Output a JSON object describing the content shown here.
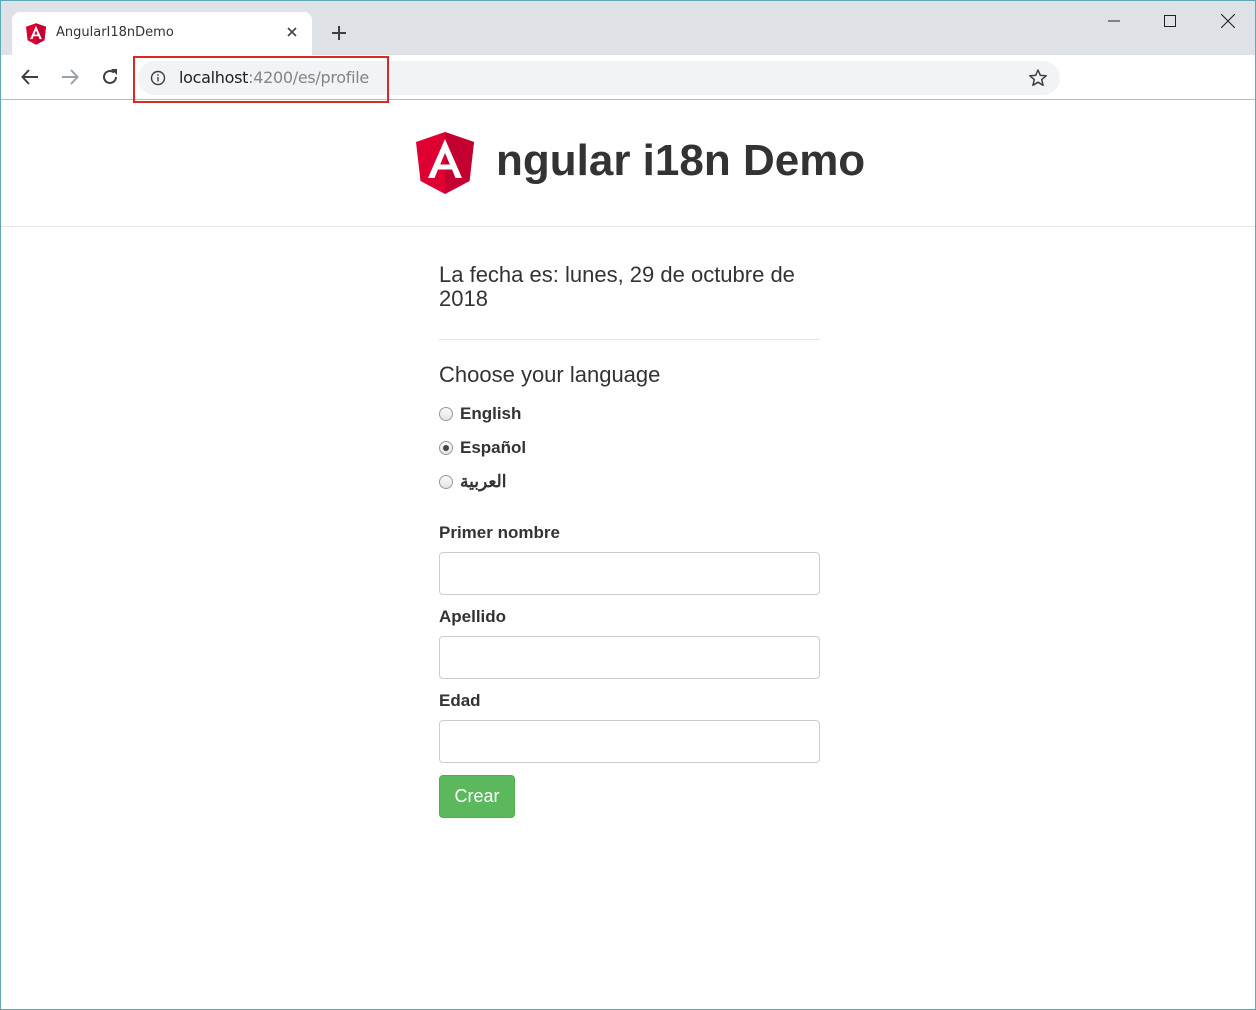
{
  "browser": {
    "tab": {
      "title": "AngularI18nDemo",
      "favicon": "angular-logo-icon",
      "close_icon": "close-icon"
    },
    "new_tab_icon": "plus-icon",
    "window_controls": [
      "minimize-icon",
      "maximize-icon",
      "close-icon"
    ],
    "toolbar": {
      "nav_icons": [
        "back-arrow-icon",
        "forward-arrow-icon",
        "reload-icon"
      ],
      "url_host": "localhost",
      "url_path": ":4200/es/profile",
      "info_icon": "info-icon",
      "bookmark_icon": "star-icon"
    },
    "highlight_color": "#d42a2a"
  },
  "app": {
    "title": "ngular i18n Demo",
    "logo_color": "#dd0031",
    "date_text": "La fecha es: lunes, 29 de octubre de 2018",
    "language": {
      "heading": "Choose your language",
      "options": [
        {
          "label": "English",
          "selected": false
        },
        {
          "label": "Español",
          "selected": true
        },
        {
          "label": "العربية",
          "selected": false
        }
      ]
    },
    "form": {
      "first_name_label": "Primer nombre",
      "first_name_value": "",
      "last_name_label": "Apellido",
      "last_name_value": "",
      "age_label": "Edad",
      "age_value": "",
      "submit_label": "Crear",
      "submit_color": "#5cb85c"
    }
  }
}
